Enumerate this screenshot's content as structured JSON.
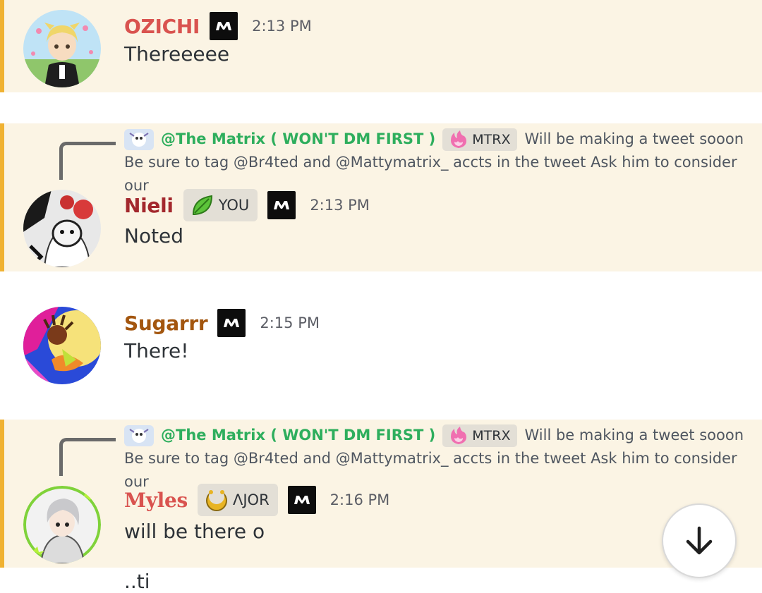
{
  "colors": {
    "highlight_bg": "#fbf4e4",
    "highlight_bar": "#f0b232",
    "mention": "#2eae5d",
    "role_chip_bg": "#e3dfd6"
  },
  "messages": [
    {
      "author": "OZICHI",
      "author_color": "#d9534f",
      "time": "2:13 PM",
      "text": "Thereeeee",
      "avatar_icon": "anime-girl-avatar",
      "badge_icon": "matrix-m-badge"
    },
    {
      "reply": {
        "mention": "@The Matrix ( WON'T DM FIRST )",
        "role": "MTRX",
        "role_icon": "pink-flame-icon",
        "text": "Will be making a tweet sooon   Be sure to tag @Br4ted and @Mattymatrix_ accts in the tweet   Ask him to consider our"
      },
      "author": "Nieli",
      "author_color": "#a3282d",
      "role": "YOU",
      "role_icon": "green-leaf-icon",
      "time": "2:13 PM",
      "text": "Noted",
      "avatar_icon": "dark-mask-avatar",
      "badge_icon": "matrix-m-badge"
    },
    {
      "author": "Sugarrr",
      "author_color": "#a3560f",
      "time": "2:15 PM",
      "text": "There!",
      "avatar_icon": "colorful-art-avatar",
      "badge_icon": "matrix-m-badge"
    },
    {
      "reply": {
        "mention": "@The Matrix ( WON'T DM FIRST )",
        "role": "MTRX",
        "role_icon": "pink-flame-icon",
        "text": "Will be making a tweet sooon   Be sure to tag @Br4ted and @Mattymatrix_ accts in the tweet   Ask him to consider our"
      },
      "author": "Myles",
      "author_color": "#d9534f",
      "role": "ΛJOR",
      "role_icon": "gold-crescent-icon",
      "time": "2:16 PM",
      "text": "will be there o",
      "avatar_icon": "silver-hair-avatar",
      "badge_icon": "matrix-m-badge"
    }
  ],
  "partial_next": "..ti",
  "scroll_button_icon": "arrow-down-icon"
}
